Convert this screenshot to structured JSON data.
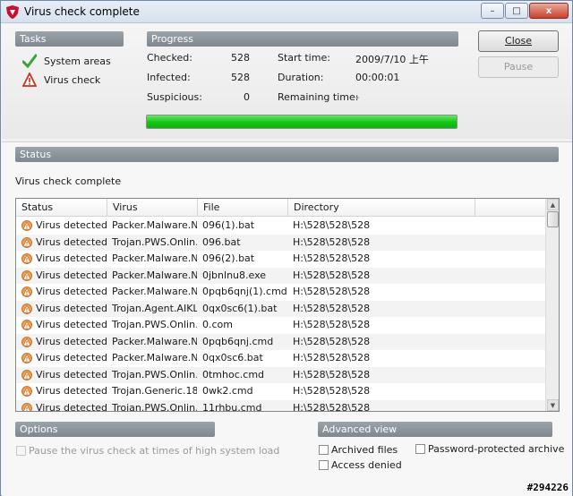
{
  "window": {
    "title": "Virus check complete",
    "controls": {
      "minimize": "–",
      "maximize": "□",
      "close": "x"
    }
  },
  "tasks": {
    "header": "Tasks",
    "items": [
      {
        "label": "System areas",
        "icon": "checkmark-icon",
        "color": "#3aa33a"
      },
      {
        "label": "Virus check",
        "icon": "warning-triangle-icon",
        "color": "#c8321e"
      }
    ]
  },
  "progress": {
    "header": "Progress",
    "checked_label": "Checked:",
    "checked_value": "528",
    "infected_label": "Infected:",
    "infected_value": "528",
    "suspicious_label": "Suspicious:",
    "suspicious_value": "0",
    "start_label": "Start time:",
    "start_value": "2009/7/10 上午",
    "duration_label": "Duration:",
    "duration_value": "00:00:01",
    "remaining_label": "Remaining time:",
    "remaining_value": "-",
    "percent": 100,
    "bar_color": "#13c613"
  },
  "buttons": {
    "close": "Close",
    "pause": "Pause"
  },
  "status": {
    "header": "Status",
    "message": "Virus check complete",
    "columns": [
      "Status",
      "Virus",
      "File",
      "Directory"
    ],
    "rows": [
      {
        "status": "Virus detected",
        "virus": "Packer.Malware.N...",
        "file": "096(1).bat",
        "directory": "H:\\528\\528\\528"
      },
      {
        "status": "Virus detected",
        "virus": "Trojan.PWS.Onlin...",
        "file": "096.bat",
        "directory": "H:\\528\\528\\528"
      },
      {
        "status": "Virus detected",
        "virus": "Packer.Malware.N...",
        "file": "096(2).bat",
        "directory": "H:\\528\\528\\528"
      },
      {
        "status": "Virus detected",
        "virus": "Packer.Malware.N...",
        "file": "0jbnlnu8.exe",
        "directory": "H:\\528\\528\\528"
      },
      {
        "status": "Virus detected",
        "virus": "Packer.Malware.N...",
        "file": "0pqb6qnj(1).cmd",
        "directory": "H:\\528\\528\\528"
      },
      {
        "status": "Virus detected",
        "virus": "Trojan.Agent.AIKL ...",
        "file": "0qx0sc6(1).bat",
        "directory": "H:\\528\\528\\528"
      },
      {
        "status": "Virus detected",
        "virus": "Trojan.PWS.Onlin...",
        "file": "0.com",
        "directory": "H:\\528\\528\\528"
      },
      {
        "status": "Virus detected",
        "virus": "Packer.Malware.N...",
        "file": "0pqb6qnj.cmd",
        "directory": "H:\\528\\528\\528"
      },
      {
        "status": "Virus detected",
        "virus": "Packer.Malware.N...",
        "file": "0qx0sc6.bat",
        "directory": "H:\\528\\528\\528"
      },
      {
        "status": "Virus detected",
        "virus": "Trojan.PWS.Onlin...",
        "file": "0tmhoc.cmd",
        "directory": "H:\\528\\528\\528"
      },
      {
        "status": "Virus detected",
        "virus": "Trojan.Generic.18...",
        "file": "0wk2.cmd",
        "directory": "H:\\528\\528\\528"
      },
      {
        "status": "Virus detected",
        "virus": "Trojan.PWS.Onlin...",
        "file": "11rhbu.cmd",
        "directory": "H:\\528\\528\\528"
      }
    ]
  },
  "options": {
    "header": "Options",
    "pause_label": "Pause the virus check at times of high system load"
  },
  "advanced": {
    "header": "Advanced view",
    "archived": "Archived files",
    "password": "Password-protected archive",
    "denied": "Access denied"
  },
  "watermark": "#294226"
}
